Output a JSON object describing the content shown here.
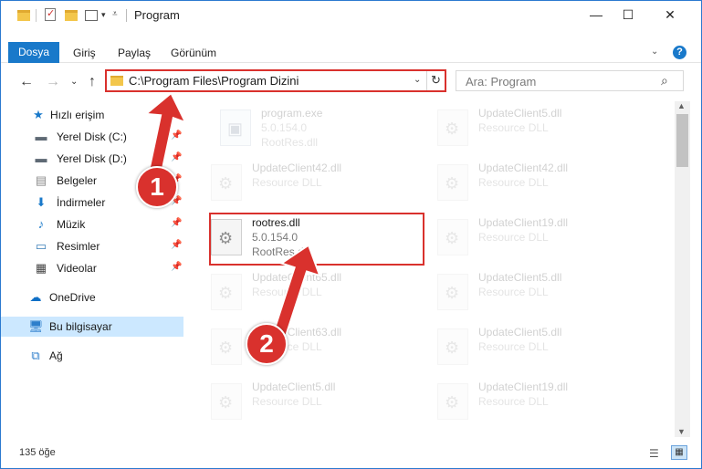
{
  "window": {
    "title": "Program",
    "controls": {
      "minimize": "—",
      "maximize": "☐",
      "close": "✕"
    }
  },
  "ribbon": {
    "tabs": [
      {
        "label": "Dosya"
      },
      {
        "label": "Giriş"
      },
      {
        "label": "Paylaş"
      },
      {
        "label": "Görünüm"
      }
    ],
    "help": "?"
  },
  "address": {
    "path": "C:\\Program Files\\Program Dizini",
    "search_placeholder": "Ara: Program"
  },
  "nav": {
    "items": [
      {
        "label": "Hızlı erişim",
        "icon": "star-icon"
      },
      {
        "label": "Yerel Disk (C:)",
        "icon": "drive-icon",
        "pinned": true
      },
      {
        "label": "Yerel Disk (D:)",
        "icon": "drive-icon",
        "pinned": true
      },
      {
        "label": "Belgeler",
        "icon": "documents-icon",
        "pinned": true
      },
      {
        "label": "İndirmeler",
        "icon": "download-icon",
        "pinned": true
      },
      {
        "label": "Müzik",
        "icon": "music-icon",
        "pinned": true
      },
      {
        "label": "Resimler",
        "icon": "pictures-icon",
        "pinned": true
      },
      {
        "label": "Videolar",
        "icon": "video-icon",
        "pinned": true
      },
      {
        "label": "OneDrive",
        "icon": "cloud-icon"
      },
      {
        "label": "Bu bilgisayar",
        "icon": "computer-icon",
        "selected": true
      },
      {
        "label": "Ağ",
        "icon": "network-icon"
      }
    ]
  },
  "files": [
    {
      "name": "program.exe",
      "line2": "5.0.154.0",
      "line3": "RootRes.dll",
      "kind": "exe",
      "faded": true
    },
    {
      "name": "UpdateClient5.dll",
      "line2": "Resource DLL",
      "line3": "",
      "kind": "dll",
      "faded": true
    },
    {
      "name": "UpdateClient42.dll",
      "line2": "Resource DLL",
      "line3": "",
      "kind": "dll",
      "faded": true
    },
    {
      "name": "UpdateClient42.dll",
      "line2": "Resource DLL",
      "line3": "",
      "kind": "dll",
      "faded": true
    },
    {
      "name": "rootres.dll",
      "line2": "5.0.154.0",
      "line3": "RootRes.dll",
      "kind": "dll",
      "faded": false
    },
    {
      "name": "UpdateClient19.dll",
      "line2": "Resource DLL",
      "line3": "",
      "kind": "dll",
      "faded": true
    },
    {
      "name": "UpdateClient65.dll",
      "line2": "Resource DLL",
      "line3": "",
      "kind": "dll",
      "faded": true
    },
    {
      "name": "UpdateClient5.dll",
      "line2": "Resource DLL",
      "line3": "",
      "kind": "dll",
      "faded": true
    },
    {
      "name": "UpdateClient63.dll",
      "line2": "Resource DLL",
      "line3": "",
      "kind": "dll",
      "faded": true
    },
    {
      "name": "UpdateClient5.dll",
      "line2": "Resource DLL",
      "line3": "",
      "kind": "dll",
      "faded": true
    },
    {
      "name": "UpdateClient5.dll",
      "line2": "Resource DLL",
      "line3": "",
      "kind": "dll",
      "faded": true
    },
    {
      "name": "UpdateClient19.dll",
      "line2": "Resource DLL",
      "line3": "",
      "kind": "dll",
      "faded": true
    }
  ],
  "status": {
    "count": "135 öğe"
  },
  "annotations": {
    "step1": "1",
    "step2": "2",
    "color": "#d9312d"
  }
}
